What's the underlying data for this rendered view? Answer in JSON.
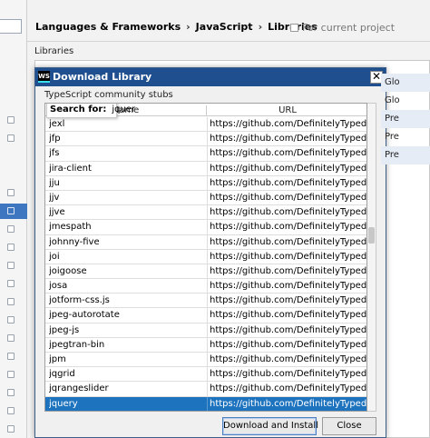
{
  "settings": {
    "breadcrumb": [
      "Languages & Frameworks",
      "JavaScript",
      "Libraries"
    ],
    "scope_text": "For current project",
    "libraries_label": "Libraries",
    "bg_rows": [
      {
        "text": "Glo",
        "alt": true
      },
      {
        "text": "Glo",
        "alt": false
      },
      {
        "text": "Pre",
        "alt": true
      },
      {
        "text": "Pre",
        "alt": false
      },
      {
        "text": "Pre",
        "alt": true
      }
    ]
  },
  "dialog": {
    "logo": "WS",
    "title": "Download Library",
    "close_glyph": "✕",
    "stubs_label": "TypeScript community stubs",
    "search": {
      "label": "Search for:",
      "value": "jquer"
    },
    "columns": {
      "name": "Name",
      "url": "URL"
    },
    "rows": [
      {
        "name": "jexl",
        "url": "https://github.com/DefinitelyTyped/Defini..."
      },
      {
        "name": "jfp",
        "url": "https://github.com/DefinitelyTyped/Defini..."
      },
      {
        "name": "jfs",
        "url": "https://github.com/DefinitelyTyped/Defini..."
      },
      {
        "name": "jira-client",
        "url": "https://github.com/DefinitelyTyped/Defini..."
      },
      {
        "name": "jju",
        "url": "https://github.com/DefinitelyTyped/Defini..."
      },
      {
        "name": "jjv",
        "url": "https://github.com/DefinitelyTyped/Defini..."
      },
      {
        "name": "jjve",
        "url": "https://github.com/DefinitelyTyped/Defini..."
      },
      {
        "name": "jmespath",
        "url": "https://github.com/DefinitelyTyped/Defini..."
      },
      {
        "name": "johnny-five",
        "url": "https://github.com/DefinitelyTyped/Defini..."
      },
      {
        "name": "joi",
        "url": "https://github.com/DefinitelyTyped/Defini..."
      },
      {
        "name": "joigoose",
        "url": "https://github.com/DefinitelyTyped/Defini..."
      },
      {
        "name": "josa",
        "url": "https://github.com/DefinitelyTyped/Defini..."
      },
      {
        "name": "jotform-css.js",
        "url": "https://github.com/DefinitelyTyped/Defini..."
      },
      {
        "name": "jpeg-autorotate",
        "url": "https://github.com/DefinitelyTyped/Defini..."
      },
      {
        "name": "jpeg-js",
        "url": "https://github.com/DefinitelyTyped/Defini..."
      },
      {
        "name": "jpegtran-bin",
        "url": "https://github.com/DefinitelyTyped/Defini..."
      },
      {
        "name": "jpm",
        "url": "https://github.com/DefinitelyTyped/Defini..."
      },
      {
        "name": "jqgrid",
        "url": "https://github.com/DefinitelyTyped/Defini..."
      },
      {
        "name": "jqrangeslider",
        "url": "https://github.com/DefinitelyTyped/Defini..."
      },
      {
        "name": "jquery",
        "url": "https://github.com/DefinitelyTyped/Defini...",
        "selected": true
      }
    ],
    "buttons": {
      "install": "Download and Install",
      "cancel": "Close"
    }
  },
  "colors": {
    "selection": "#1e73be",
    "titlebar": "#1f4f8f"
  }
}
